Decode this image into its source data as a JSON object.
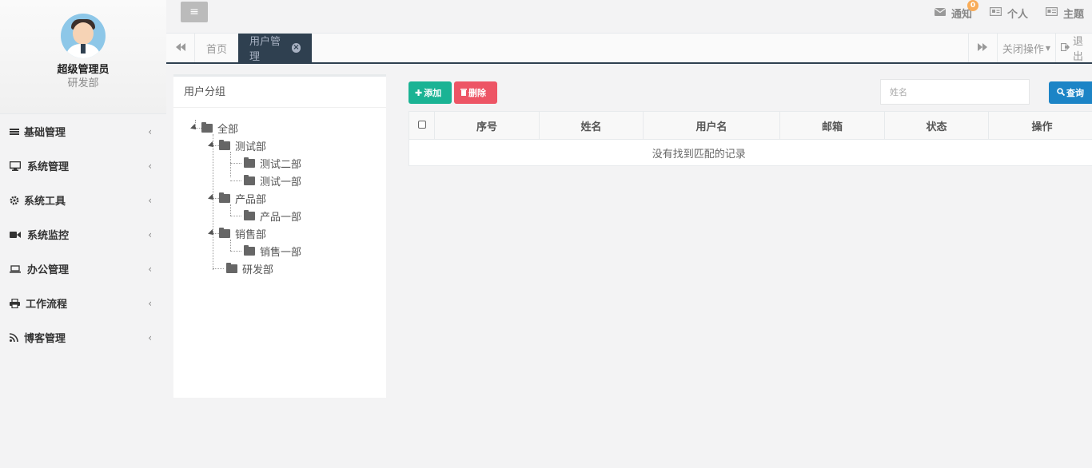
{
  "profile": {
    "name": "超级管理员",
    "dept": "研发部"
  },
  "sidebar": {
    "items": [
      {
        "label": "基础管理",
        "icon": "list-icon"
      },
      {
        "label": "系统管理",
        "icon": "desktop-icon"
      },
      {
        "label": "系统工具",
        "icon": "gear-icon"
      },
      {
        "label": "系统监控",
        "icon": "video-camera-icon"
      },
      {
        "label": "办公管理",
        "icon": "laptop-icon"
      },
      {
        "label": "工作流程",
        "icon": "print-icon"
      },
      {
        "label": "博客管理",
        "icon": "rss-icon"
      }
    ],
    "chevron": "‹"
  },
  "topbar": {
    "notify_label": "通知",
    "notify_count": "0",
    "personal_label": "个人",
    "theme_label": "主题"
  },
  "tabs": {
    "home": "首页",
    "active": "用户管理",
    "close_ops": "关闭操作",
    "logout": "退出"
  },
  "tree": {
    "title": "用户分组",
    "nodes": [
      "全部",
      "测试部",
      "测试二部",
      "测试一部",
      "产品部",
      "产品一部",
      "销售部",
      "销售一部",
      "研发部"
    ]
  },
  "toolbar": {
    "add_label": "添加",
    "delete_label": "删除",
    "search_placeholder": "姓名",
    "search_label": "查询"
  },
  "table": {
    "columns": [
      "序号",
      "姓名",
      "用户名",
      "邮箱",
      "状态",
      "操作"
    ],
    "empty_text": "没有找到匹配的记录"
  },
  "colors": {
    "accent": "#2f4050",
    "add": "#1ab394",
    "delete": "#ed5565",
    "search": "#1c84c6",
    "badge": "#f8ac59"
  }
}
